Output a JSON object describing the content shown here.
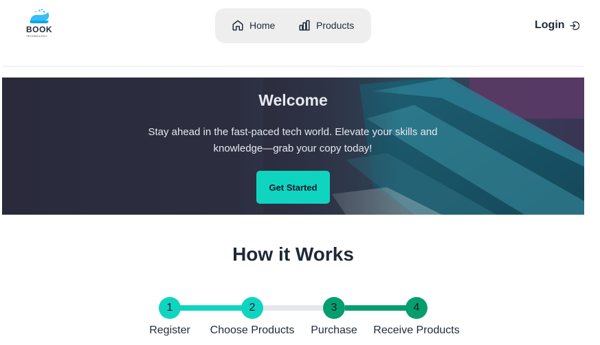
{
  "brand": {
    "name": "BOOK",
    "tagline": "TECHNOLOGY"
  },
  "nav": {
    "items": [
      {
        "label": "Home",
        "icon": "home-icon"
      },
      {
        "label": "Products",
        "icon": "bar-chart-icon"
      }
    ]
  },
  "header": {
    "login_label": "Login",
    "login_icon": "sign-in-icon"
  },
  "hero": {
    "title": "Welcome",
    "text": "Stay ahead in the fast-paced tech world. Elevate your skills and knowledge—grab your copy today!",
    "button_label": "Get Started"
  },
  "how_it_works": {
    "title": "How it Works",
    "steps": [
      {
        "number": "1",
        "label": "Register"
      },
      {
        "number": "2",
        "label": "Choose Products"
      },
      {
        "number": "3",
        "label": "Purchase"
      },
      {
        "number": "4",
        "label": "Receive Products"
      }
    ]
  },
  "colors": {
    "accent": "#0fd5c0",
    "accent_dark": "#069e6e",
    "hero_bg": "#2a2a3b",
    "nav_bg": "#eeeeef"
  }
}
